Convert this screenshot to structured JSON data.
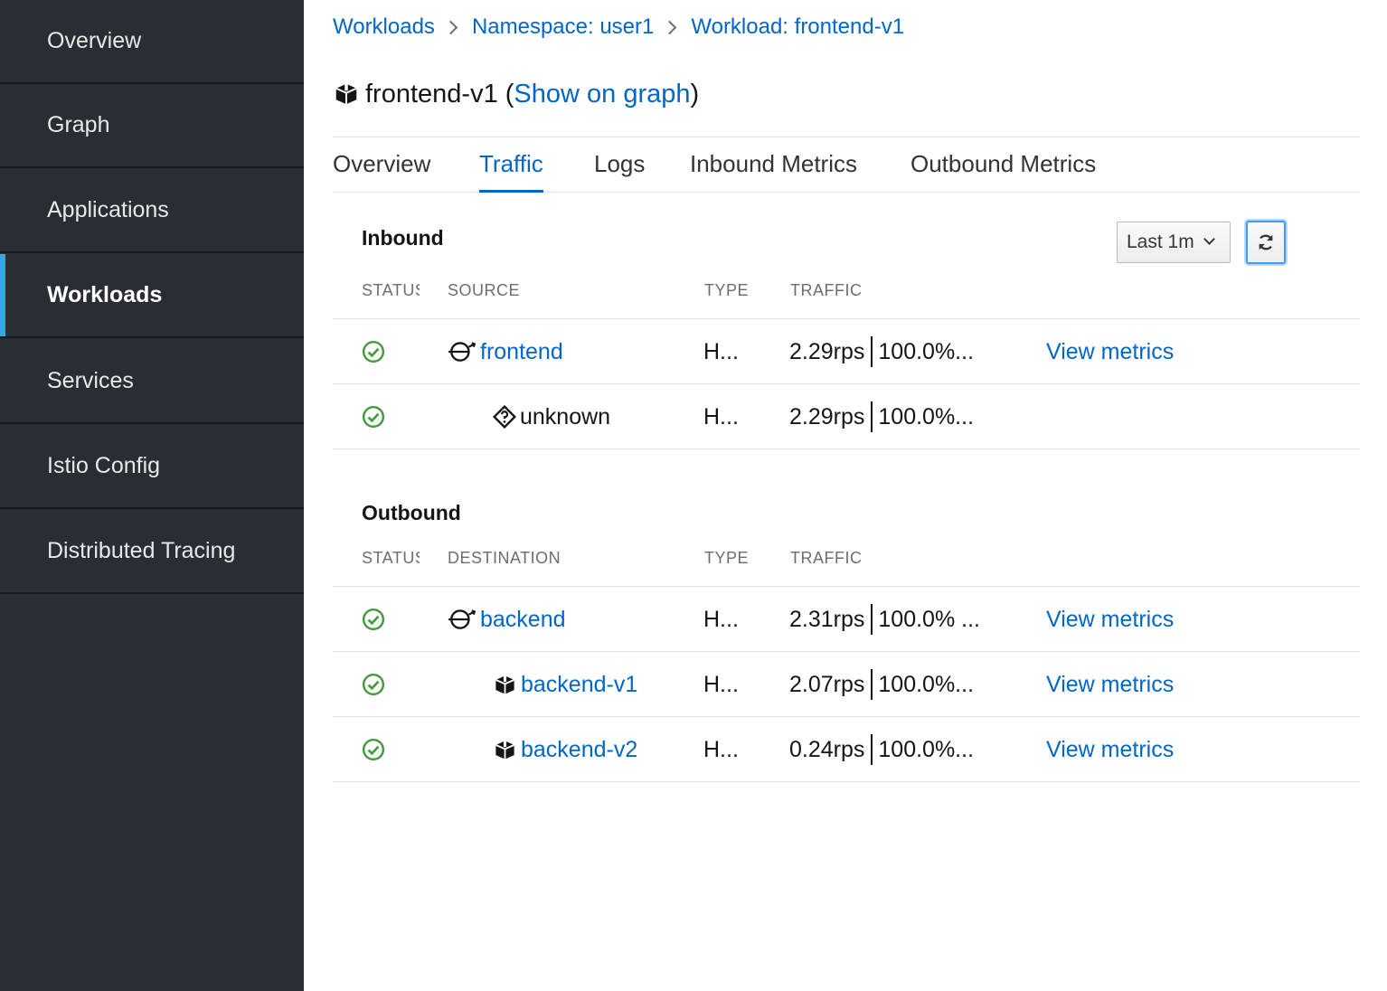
{
  "sidebar": {
    "items": [
      {
        "label": "Overview"
      },
      {
        "label": "Graph"
      },
      {
        "label": "Applications"
      },
      {
        "label": "Workloads"
      },
      {
        "label": "Services"
      },
      {
        "label": "Istio Config"
      },
      {
        "label": "Distributed Tracing"
      }
    ],
    "active": "Workloads"
  },
  "breadcrumb": [
    "Workloads",
    "Namespace: user1",
    "Workload: frontend-v1"
  ],
  "page": {
    "title": "frontend-v1",
    "open_paren": " (",
    "show_graph": "Show on graph",
    "close_paren": ")"
  },
  "tabs": [
    {
      "label": "Overview"
    },
    {
      "label": "Traffic"
    },
    {
      "label": "Logs"
    },
    {
      "label": "Inbound Metrics"
    },
    {
      "label": "Outbound Metrics"
    }
  ],
  "active_tab": "Traffic",
  "controls": {
    "time_range": "Last 1m",
    "refresh_icon": "refresh-icon"
  },
  "inbound": {
    "title": "Inbound",
    "headers": {
      "status": "STATUS",
      "name": "SOURCE",
      "type": "TYPE",
      "traffic": "TRAFFIC"
    },
    "rows": [
      {
        "status": "healthy",
        "icon": "service-icon",
        "name": "frontend",
        "type": "H...",
        "rps": "2.29rps",
        "pct": "100.0%...",
        "metrics": "View metrics"
      },
      {
        "status": "healthy",
        "icon": "unknown-icon",
        "name": "unknown",
        "type": "H...",
        "rps": "2.29rps",
        "pct": "100.0%...",
        "metrics": ""
      }
    ]
  },
  "outbound": {
    "title": "Outbound",
    "headers": {
      "status": "STATUS",
      "name": "DESTINATION",
      "type": "TYPE",
      "traffic": "TRAFFIC"
    },
    "rows": [
      {
        "status": "healthy",
        "icon": "service-icon",
        "name": "backend",
        "type": "H...",
        "rps": "2.31rps",
        "pct": "100.0% ...",
        "metrics": "View metrics"
      },
      {
        "status": "healthy",
        "icon": "workload-icon",
        "name": "backend-v1",
        "type": "H...",
        "rps": "2.07rps",
        "pct": "100.0%...",
        "metrics": "View metrics"
      },
      {
        "status": "healthy",
        "icon": "workload-icon",
        "name": "backend-v2",
        "type": "H...",
        "rps": "0.24rps",
        "pct": "100.0%...",
        "metrics": "View metrics"
      }
    ]
  },
  "colors": {
    "link": "#0066cc",
    "ok": "#3f9c35",
    "sidebar_bg": "#292e34",
    "active_indicator": "#39a5dc"
  }
}
